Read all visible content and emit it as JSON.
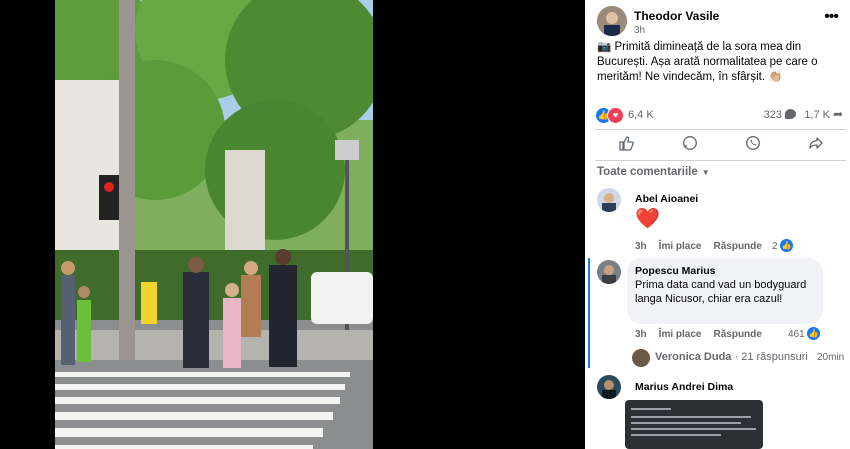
{
  "post": {
    "author": "Theodor Vasile",
    "time": "3h",
    "more": "•••",
    "caption": "📷 Primită dimineață de la sora mea din București. Așa arată normalitatea pe care o merităm! Ne vindecăm, în sfârșit. 👏🏼",
    "reactions_count": "6,4 K",
    "comments_count": "323",
    "shares_count": "1,7 K"
  },
  "actions": {
    "like_icon": "like-icon",
    "comment_icon": "comment-icon",
    "whatsapp_icon": "whatsapp-icon",
    "share_icon": "share-icon"
  },
  "sort_label": "Toate comentariile",
  "comments": [
    {
      "name": "Abel Aioanei",
      "text": "❤️",
      "time": "3h",
      "like": "Îmi place",
      "reply": "Răspunde",
      "likes": "2"
    },
    {
      "name": "Popescu Marius",
      "text": "Prima data cand vad un bodyguard langa Nicusor, chiar era cazul!",
      "time": "3h",
      "like": "Îmi place",
      "reply": "Răspunde",
      "likes": "461"
    },
    {
      "name": "Marius Andrei Dima"
    }
  ],
  "replies": {
    "name": "Veronica Duda",
    "summary": " · 21 răspunsuri",
    "time": "20min"
  },
  "colors": {
    "accent": "#1877f2",
    "love": "#f33e58",
    "secondary_text": "#65676b"
  }
}
